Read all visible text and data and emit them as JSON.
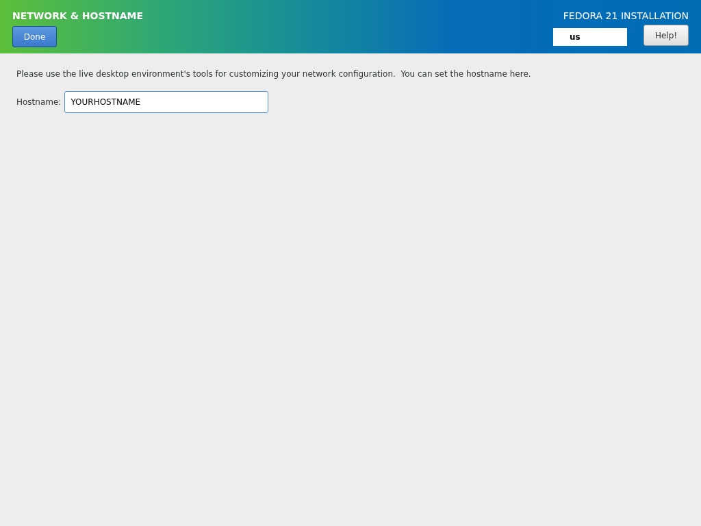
{
  "header": {
    "title": "NETWORK & HOSTNAME",
    "done_button": "Done",
    "product": "FEDORA 21 INSTALLATION",
    "keyboard_layout": "us",
    "help_button": "Help!"
  },
  "content": {
    "description": "Please use the live desktop environment's tools for customizing your network configuration.  You can set the hostname here.",
    "hostname_label": "Hostname:",
    "hostname_value": "YOURHOSTNAME"
  }
}
